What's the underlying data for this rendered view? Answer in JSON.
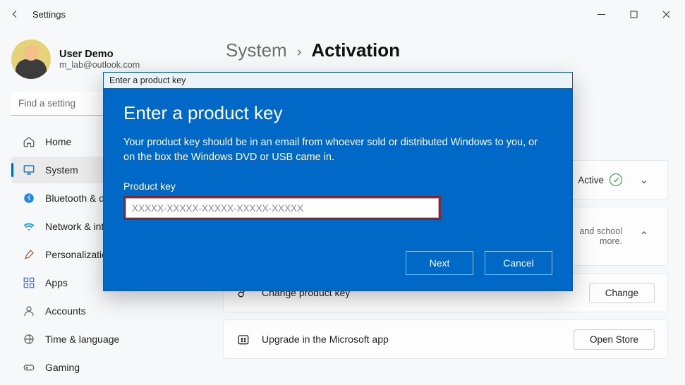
{
  "titlebar": {
    "app_title": "Settings"
  },
  "user": {
    "name": "User Demo",
    "email": "m_lab@outlook.com"
  },
  "search": {
    "placeholder": "Find a setting"
  },
  "sidebar": {
    "items": [
      {
        "label": "Home"
      },
      {
        "label": "System"
      },
      {
        "label": "Bluetooth & devices"
      },
      {
        "label": "Network & internet"
      },
      {
        "label": "Personalization"
      },
      {
        "label": "Apps"
      },
      {
        "label": "Accounts"
      },
      {
        "label": "Time & language"
      },
      {
        "label": "Gaming"
      }
    ]
  },
  "breadcrumb": {
    "parent": "System",
    "sep": "›",
    "current": "Activation"
  },
  "cards": {
    "status": {
      "value": "Active"
    },
    "expand": {
      "sub_line1": "and school",
      "sub_line2": "more."
    },
    "change_key": {
      "label": "Change product key",
      "button": "Change"
    },
    "store": {
      "label": "Upgrade in the Microsoft app",
      "button": "Open Store"
    }
  },
  "dialog": {
    "window_title": "Enter a product key",
    "heading": "Enter a product key",
    "body": "Your product key should be in an email from whoever sold or distributed Windows to you, or on the box the Windows DVD or USB came in.",
    "field_label": "Product key",
    "placeholder": "XXXXX-XXXXX-XXXXX-XXXXX-XXXXX",
    "next": "Next",
    "cancel": "Cancel"
  }
}
